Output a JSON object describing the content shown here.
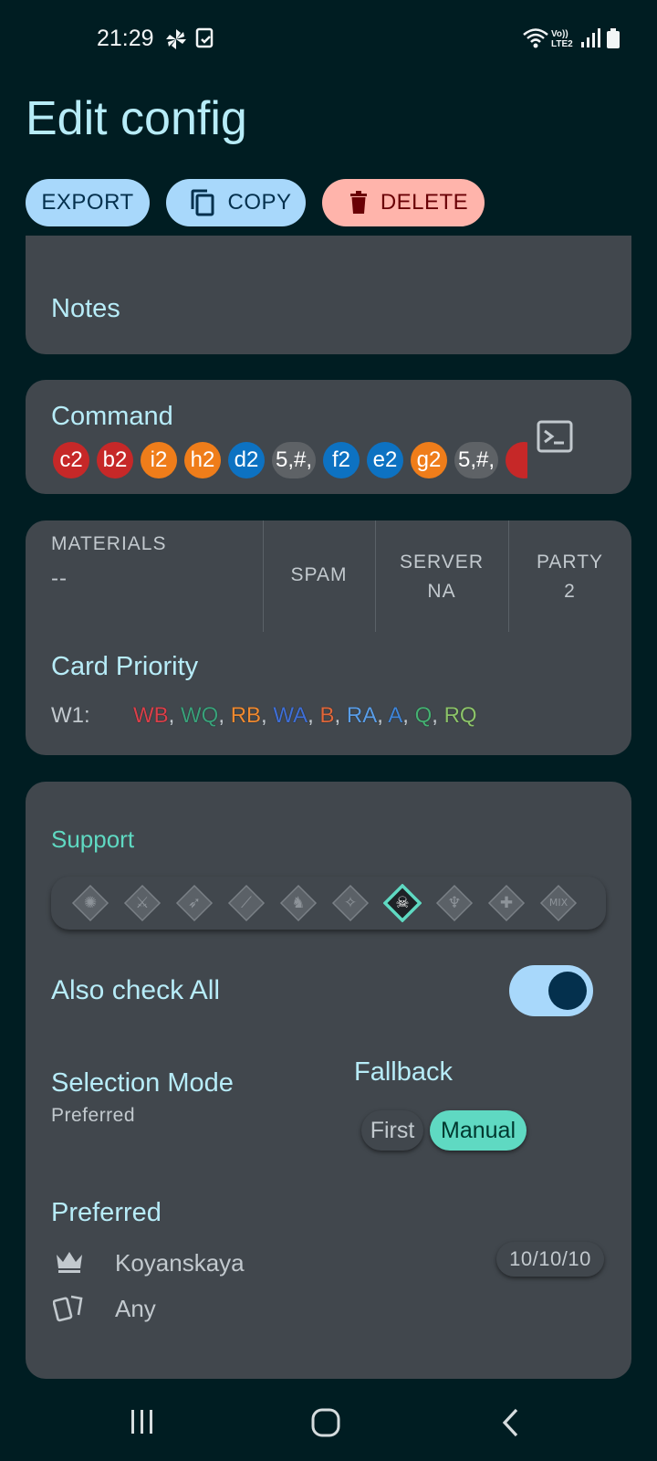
{
  "status_bar": {
    "time": "21:29",
    "icons": [
      "pinwheel-icon",
      "screenshot-icon",
      "wifi-icon",
      "volte-icon",
      "signal-icon",
      "battery-icon"
    ],
    "volte_text": "Vo)) LTE2"
  },
  "title": "Edit config",
  "actions": {
    "export_label": "EXPORT",
    "copy_label": "COPY",
    "delete_label": "DELETE"
  },
  "notes": {
    "label": "Notes"
  },
  "command": {
    "label": "Command",
    "chips": [
      {
        "text": "c2",
        "color": "#c62828"
      },
      {
        "text": "b2",
        "color": "#c62828"
      },
      {
        "text": "i2",
        "color": "#ef7d1a"
      },
      {
        "text": "h2",
        "color": "#ef7d1a"
      },
      {
        "text": "d2",
        "color": "#0d72c2"
      },
      {
        "text": "5,#,",
        "color": "#5e6266"
      },
      {
        "text": "f2",
        "color": "#0d72c2"
      },
      {
        "text": "e2",
        "color": "#0d72c2"
      },
      {
        "text": "g2",
        "color": "#ef7d1a"
      },
      {
        "text": "5,#,",
        "color": "#5e6266"
      },
      {
        "text": "",
        "color": "#c62828"
      }
    ]
  },
  "info": {
    "materials_label": "MATERIALS",
    "materials_value": "--",
    "spam_label": "SPAM",
    "server_label": "SERVER",
    "server_value": "NA",
    "party_label": "PARTY",
    "party_value": "2"
  },
  "card_priority": {
    "label": "Card Priority",
    "wave": "W1:",
    "cards": [
      {
        "text": "WB",
        "color": "#d9404a"
      },
      {
        "text": "WQ",
        "color": "#3aa07a"
      },
      {
        "text": "RB",
        "color": "#f08a30"
      },
      {
        "text": "WA",
        "color": "#3f6fd6"
      },
      {
        "text": "B",
        "color": "#e0673a"
      },
      {
        "text": "RA",
        "color": "#5a9ee8"
      },
      {
        "text": "A",
        "color": "#3f85d8"
      },
      {
        "text": "Q",
        "color": "#45b072"
      },
      {
        "text": "RQ",
        "color": "#8cc36a"
      }
    ]
  },
  "support": {
    "label": "Support",
    "classes": [
      "all-class-icon",
      "saber-icon",
      "archer-icon",
      "lancer-icon",
      "rider-icon",
      "caster-icon",
      "assassin-icon",
      "berserker-icon",
      "extra-class-icon",
      "mix-icon"
    ],
    "selected_class": "assassin-icon",
    "mix_text": "MIX",
    "also_check_label": "Also check All",
    "also_check_on": true,
    "selection_mode_label": "Selection Mode",
    "selection_mode_value": "Preferred",
    "fallback_label": "Fallback",
    "fallback_first": "First",
    "fallback_manual": "Manual",
    "fallback_selected": "Manual",
    "preferred_label": "Preferred",
    "servant": "Koyanskaya",
    "servant_level": "10/10/10",
    "craft_essence": "Any"
  },
  "nav_bar": {
    "icons": [
      "recents-icon",
      "home-icon",
      "back-icon"
    ]
  }
}
